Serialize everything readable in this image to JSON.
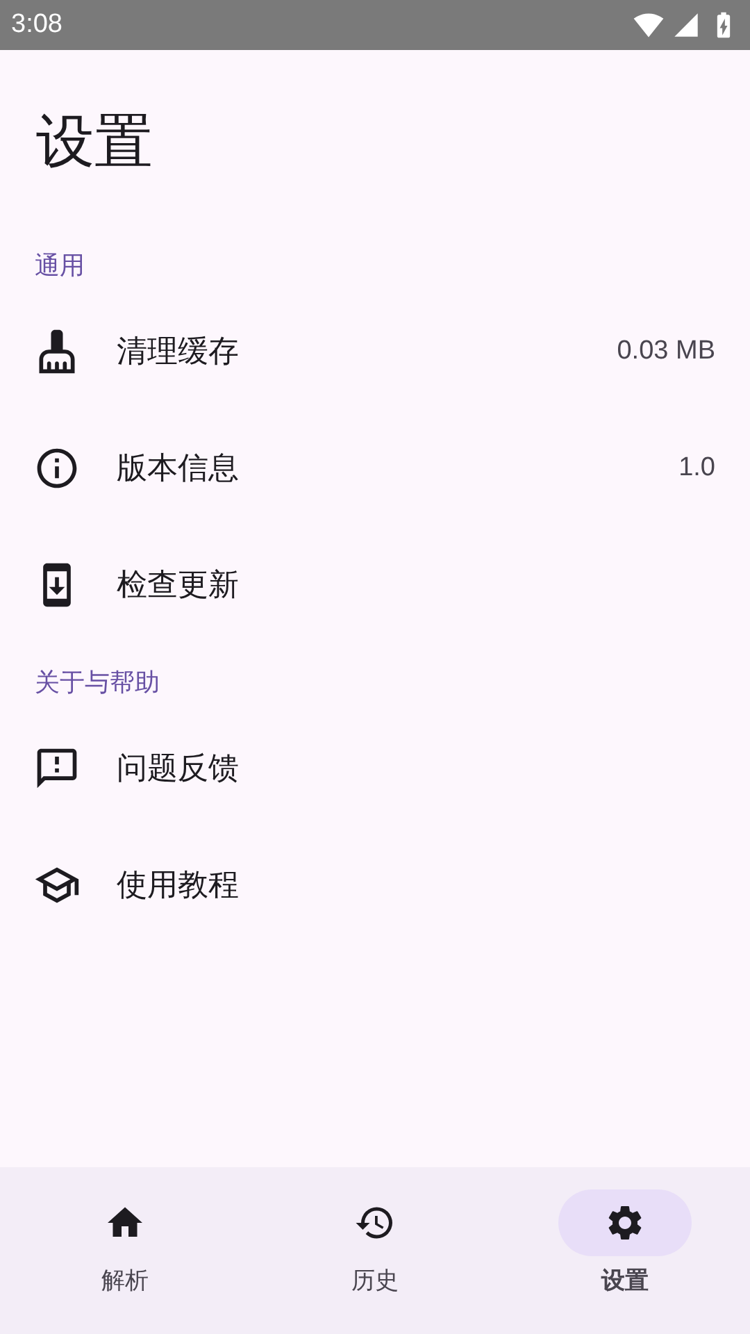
{
  "status_bar": {
    "time": "3:08"
  },
  "title": "设置",
  "sections": [
    {
      "header": "通用",
      "items": [
        {
          "label": "清理缓存",
          "value": "0.03 MB"
        },
        {
          "label": "版本信息",
          "value": "1.0"
        },
        {
          "label": "检查更新"
        }
      ]
    },
    {
      "header": "关于与帮助",
      "items": [
        {
          "label": "问题反馈"
        },
        {
          "label": "使用教程"
        }
      ]
    }
  ],
  "nav": [
    {
      "label": "解析",
      "selected": false
    },
    {
      "label": "历史",
      "selected": false
    },
    {
      "label": "设置",
      "selected": true
    }
  ]
}
